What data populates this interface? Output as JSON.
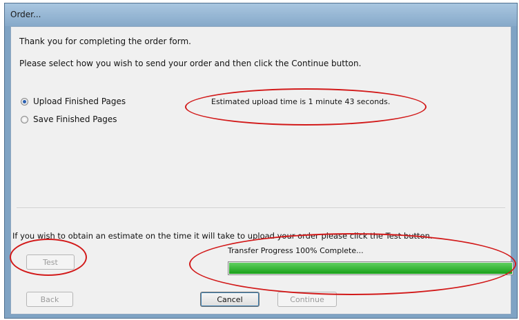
{
  "window": {
    "title": "Order..."
  },
  "dialog": {
    "intro": "Thank you for completing the order form.",
    "instruction": "Please select how you wish to send your order and then click the Continue button.",
    "options": [
      {
        "label": "Upload Finished Pages",
        "selected": true
      },
      {
        "label": "Save Finished Pages",
        "selected": false
      }
    ],
    "estimate_text": "Estimated upload time is 1 minute 43 seconds.",
    "test_hint": "If you wish to obtain an estimate on the time it will take to upload your order please click the Test button.",
    "test_button": {
      "label": "Test",
      "enabled": false
    },
    "progress": {
      "label": "Transfer Progress 100% Complete...",
      "value": 100
    },
    "buttons": {
      "back": {
        "label": "Back",
        "enabled": false
      },
      "cancel": {
        "label": "Cancel",
        "enabled": true
      },
      "continue": {
        "label": "Continue",
        "enabled": false
      }
    }
  },
  "colors": {
    "progress_fill": "#19a019",
    "annotation": "#d21919",
    "titlebar": "#8fb0cf"
  }
}
